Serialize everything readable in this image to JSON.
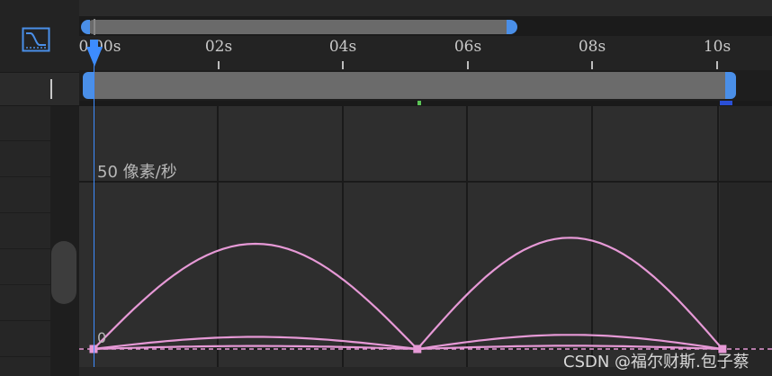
{
  "timeline": {
    "ruler_ticks": [
      "0:00s",
      "02s",
      "04s",
      "06s",
      "08s",
      "10s"
    ],
    "speed_label": "50 像素/秒",
    "zero_label": "0",
    "watermark": "CSDN @福尔财斯.包子蔡"
  },
  "icons": {
    "graph_editor": "graph-editor-icon",
    "playhead": "playhead-icon"
  },
  "colors": {
    "curve": "#e699d6",
    "accent": "#4a8fe8",
    "grid": "#1a1a1a",
    "marker_green": "#5bc456"
  },
  "chart_data": {
    "type": "line",
    "x_label_ticks": [
      "0:00s",
      "02s",
      "04s",
      "06s",
      "08s",
      "10s"
    ],
    "y_label": "50 像素/秒",
    "y_baseline_label": "0",
    "series": [
      {
        "x": [
          0,
          5.2,
          10.1
        ],
        "values": [
          0,
          0,
          0
        ],
        "arcs": [
          [
            0,
            2.6,
            5.2,
            52
          ],
          [
            5.2,
            7.7,
            10.1,
            55
          ]
        ]
      },
      {
        "x": [
          0,
          5.2,
          10.1
        ],
        "values": [
          0,
          0,
          0
        ],
        "arcs": [
          [
            0,
            2.6,
            5.2,
            6
          ],
          [
            5.2,
            7.7,
            10.1,
            7
          ]
        ]
      },
      {
        "x": [
          0,
          5.2,
          10.1
        ],
        "values": [
          0,
          0,
          0
        ],
        "arcs": [
          [
            0,
            2.6,
            5.2,
            1.5
          ],
          [
            5.2,
            7.7,
            10.1,
            1.6
          ]
        ]
      }
    ]
  }
}
